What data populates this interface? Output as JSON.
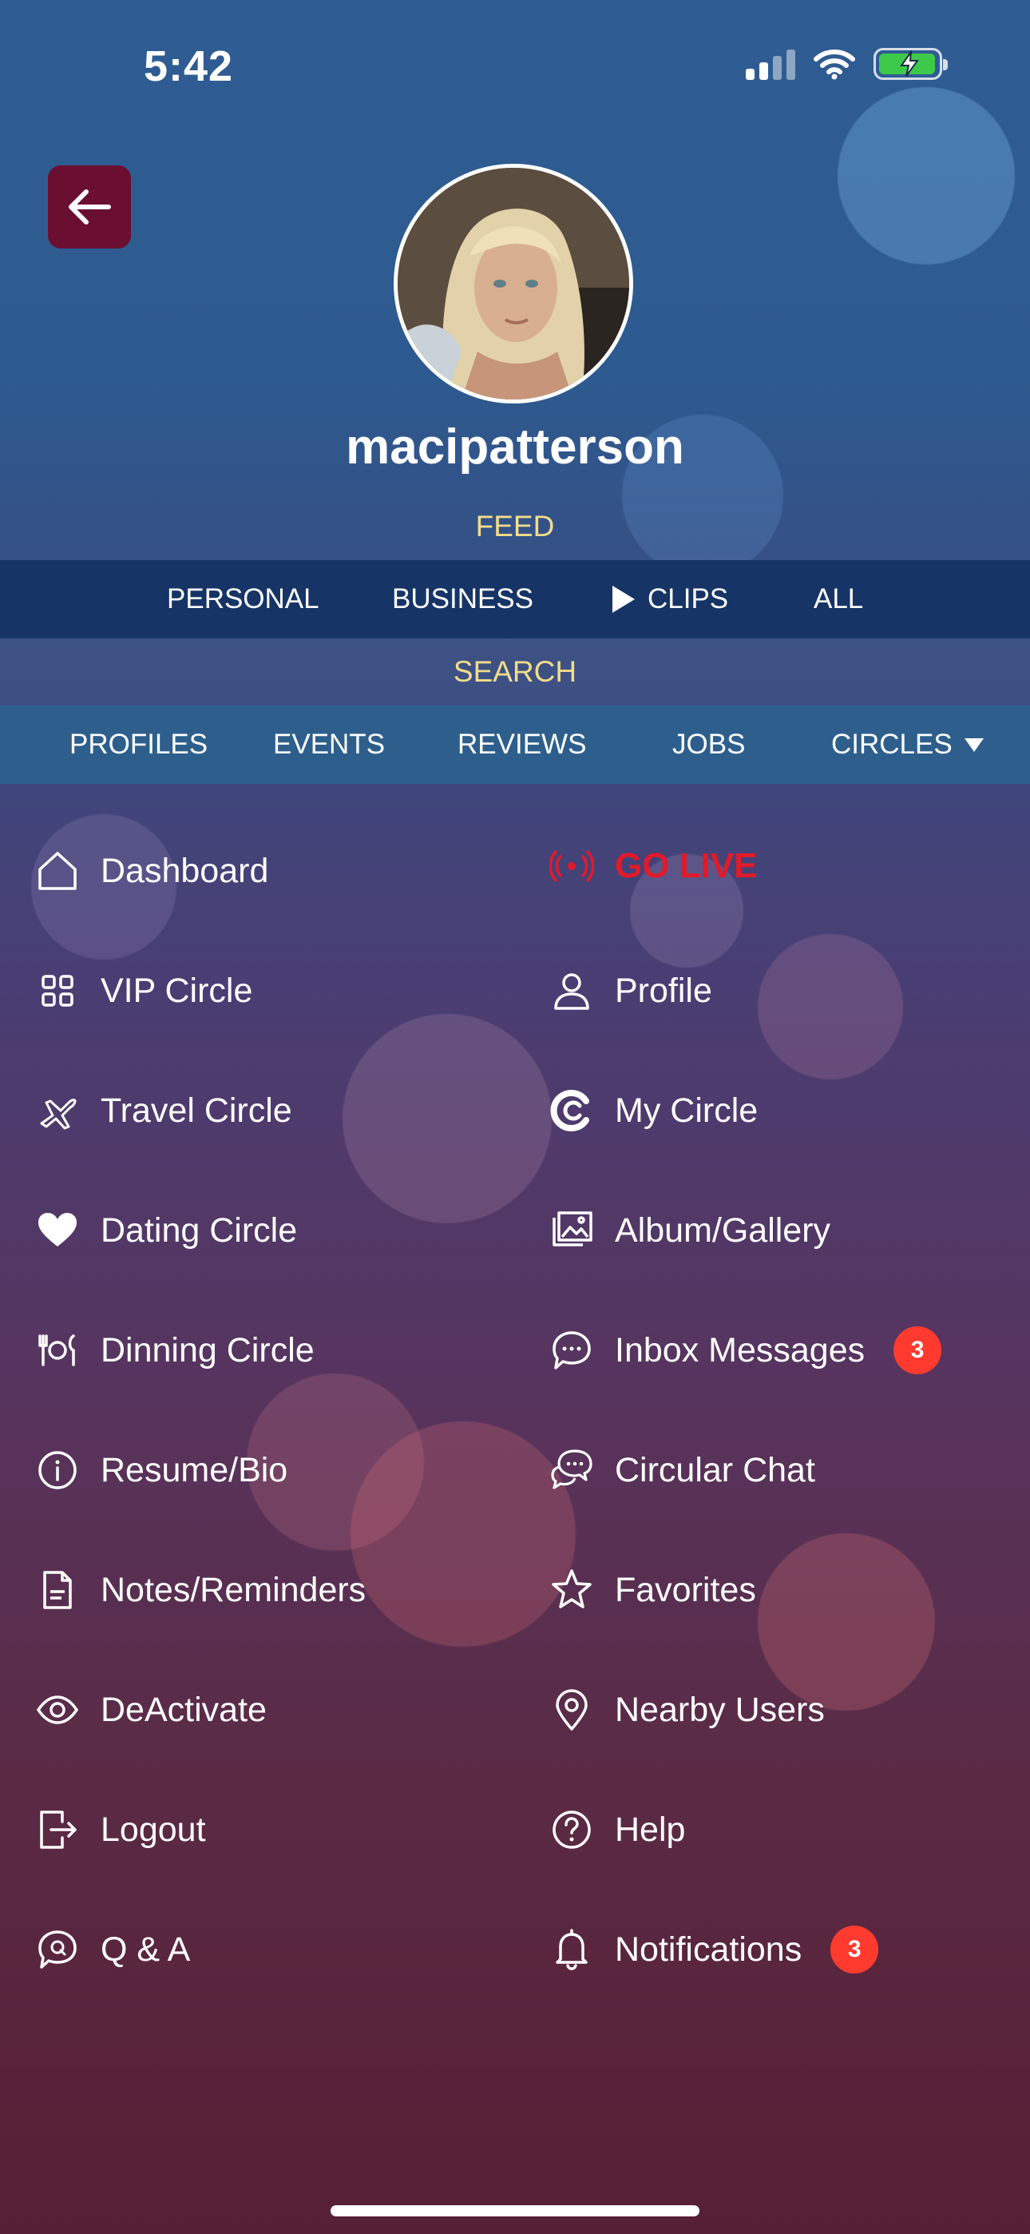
{
  "status_bar": {
    "time": "5:42"
  },
  "profile": {
    "username": "macipatterson"
  },
  "feed": {
    "label": "FEED",
    "tabs": [
      "PERSONAL",
      "BUSINESS",
      "CLIPS",
      "ALL"
    ]
  },
  "search": {
    "label": "SEARCH",
    "tabs": [
      "PROFILES",
      "EVENTS",
      "REVIEWS",
      "JOBS",
      "CIRCLES"
    ]
  },
  "menu": {
    "left": [
      {
        "label": "Dashboard",
        "icon": "home-icon"
      },
      {
        "label": "VIP Circle",
        "icon": "grid-icon"
      },
      {
        "label": "Travel Circle",
        "icon": "airplane-icon"
      },
      {
        "label": "Dating Circle",
        "icon": "heart-icon"
      },
      {
        "label": "Dinning Circle",
        "icon": "dining-icon"
      },
      {
        "label": "Resume/Bio",
        "icon": "info-icon"
      },
      {
        "label": "Notes/Reminders",
        "icon": "document-icon"
      },
      {
        "label": "DeActivate",
        "icon": "eye-icon"
      },
      {
        "label": "Logout",
        "icon": "logout-icon"
      },
      {
        "label": "Q & A",
        "icon": "qa-bubble-icon"
      }
    ],
    "right": [
      {
        "label": "GO LIVE",
        "icon": "broadcast-icon"
      },
      {
        "label": "Profile",
        "icon": "user-icon"
      },
      {
        "label": "My Circle",
        "icon": "circle-logo-icon"
      },
      {
        "label": "Album/Gallery",
        "icon": "gallery-icon"
      },
      {
        "label": "Inbox Messages",
        "icon": "chat-bubble-icon",
        "badge": "3"
      },
      {
        "label": "Circular Chat",
        "icon": "group-chat-icon"
      },
      {
        "label": "Favorites",
        "icon": "star-icon"
      },
      {
        "label": "Nearby Users",
        "icon": "location-pin-icon"
      },
      {
        "label": "Help",
        "icon": "help-icon"
      },
      {
        "label": "Notifications",
        "icon": "bell-icon",
        "badge": "3"
      }
    ]
  },
  "colors": {
    "back_button": "#6a0f30",
    "feed_bar": "#163466",
    "search_bar": "#2e5f8c",
    "accent_yellow": "#f2dd8a",
    "go_live_red": "#e11a2a",
    "badge_red": "#ff3b30"
  }
}
